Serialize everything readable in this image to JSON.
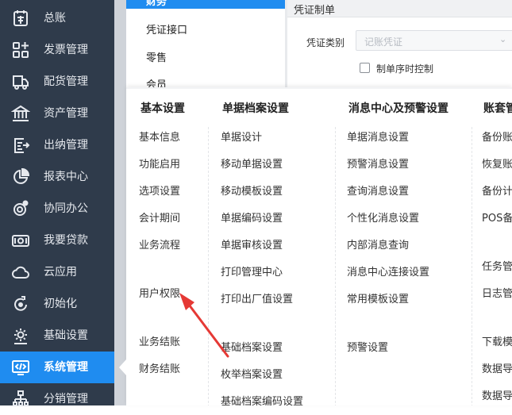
{
  "sidebar": {
    "items": [
      {
        "label": "总账",
        "icon": "ledger-icon"
      },
      {
        "label": "发票管理",
        "icon": "invoice-grid-icon"
      },
      {
        "label": "配货管理",
        "icon": "delivery-truck-icon"
      },
      {
        "label": "资产管理",
        "icon": "bank-building-icon"
      },
      {
        "label": "出纳管理",
        "icon": "cashier-doc-icon"
      },
      {
        "label": "报表中心",
        "icon": "pie-chart-icon"
      },
      {
        "label": "协同办公",
        "icon": "collaboration-icon"
      },
      {
        "label": "我要贷款",
        "icon": "cash-note-icon"
      },
      {
        "label": "云应用",
        "icon": "cloud-icon"
      },
      {
        "label": "初始化",
        "icon": "refresh-icon"
      },
      {
        "label": "基础设置",
        "icon": "gear-icon"
      },
      {
        "label": "系统管理",
        "icon": "code-monitor-icon",
        "active": true
      },
      {
        "label": "分销管理",
        "icon": "org-tree-icon"
      }
    ]
  },
  "sub_menu": {
    "items": [
      "财务",
      "凭证接口",
      "零售",
      "会员"
    ],
    "active_index": 0
  },
  "settings": {
    "title": "凭证制单",
    "voucher_type_label": "凭证类别",
    "voucher_type_placeholder": "记账凭证",
    "sequence_checkbox_label": "制单序时控制",
    "sequence_checked": false
  },
  "menu": {
    "columns": [
      {
        "heading": "基本设置",
        "items": [
          "基本信息",
          "功能启用",
          "选项设置",
          "会计期间",
          "业务流程",
          "用户权限",
          "业务结账",
          "财务结账"
        ]
      },
      {
        "heading": "单据档案设置",
        "items": [
          "单据设计",
          "移动单据设置",
          "移动模板设置",
          "单据编码设置",
          "单据审核设置",
          "打印管理中心",
          "打印出厂值设置",
          "基础档案设置",
          "枚举档案设置",
          "基础档案编码设置"
        ]
      },
      {
        "heading": "消息中心及预警设置",
        "items": [
          "单据消息设置",
          "预警消息设置",
          "查询消息设置",
          "个性化消息设置",
          "内部消息查询",
          "消息中心连接设置",
          "常用模板设置",
          "预警设置"
        ]
      },
      {
        "heading": "账套管",
        "items": [
          "备份账",
          "恢复账",
          "备份计",
          "POS备",
          "任务管",
          "日志管",
          "下载模",
          "数据导",
          "数据导"
        ]
      }
    ]
  },
  "annotation": {
    "arrow_color": "#e53935",
    "target": "用户权限"
  },
  "colors": {
    "sidebar_bg": "#2f3b4b",
    "accent": "#1f8cf0"
  }
}
